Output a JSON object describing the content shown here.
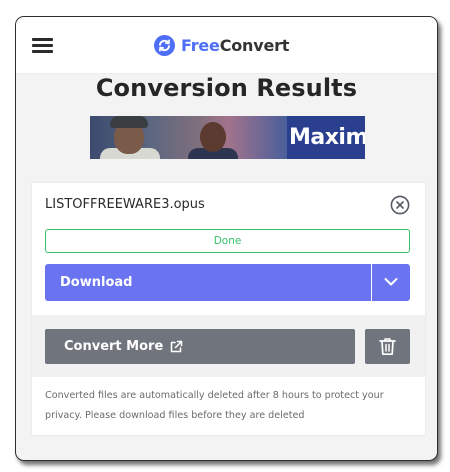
{
  "header": {
    "logo_free": "Free",
    "logo_convert": "Convert",
    "menu_icon": "hamburger-menu-icon",
    "logo_icon": "refresh-circle-icon"
  },
  "page": {
    "title": "Conversion Results"
  },
  "ad": {
    "text": "Maximu"
  },
  "result": {
    "filename": "LISTOFFREEWARE3.opus",
    "status": "Done",
    "download_label": "Download",
    "convert_more_label": "Convert More",
    "notice": "Converted files are automatically deleted after 8 hours to protect your privacy. Please download files before they are deleted",
    "close_icon": "close-circle-icon",
    "dropdown_icon": "chevron-down-icon",
    "external_icon": "external-link-icon",
    "delete_icon": "trash-icon"
  },
  "colors": {
    "brand_blue": "#4f6ef7",
    "download_button": "#6a74f0",
    "done_green": "#37c26b",
    "secondary_button": "#6f747d"
  }
}
